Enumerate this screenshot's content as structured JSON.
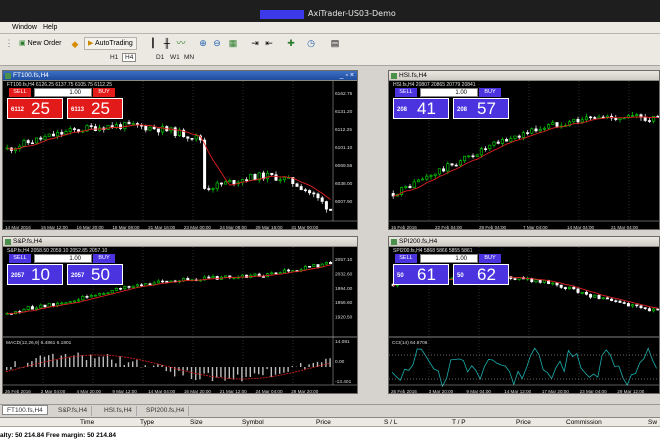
{
  "window": {
    "title": "AxiTrader-US03-Demo"
  },
  "menu": [
    "Window",
    "Help"
  ],
  "toolbar": {
    "new_order": "New Order",
    "autotrading": "AutoTrading",
    "timeframes": [
      "H1",
      "H4",
      "D1",
      "W1",
      "MN"
    ],
    "active_timeframe": "H4"
  },
  "charts": [
    {
      "title": "FT100.fs,H4",
      "info": "FT100.fs,H4  6126.25 6137.75 6105.75 6112.25",
      "active": true,
      "color": "#e41b1b",
      "panel": {
        "sell": "SELL",
        "buy": "BUY",
        "lot": "1.00",
        "sell_small": "6112",
        "sell_big": "25",
        "buy_small": "6113",
        "buy_big": "25"
      },
      "price_labels": [
        "6162.75",
        "6131.20",
        "6112.25",
        "6101.10",
        "6069.55",
        "6038.00",
        "6007.90"
      ],
      "date_labels": [
        "14 Mar 2016",
        "15 Mar 12:00",
        "16 Mar 20:00",
        "18 Mar 08:00",
        "21 Mar 16:00",
        "23 Mar 00:00",
        "24 Mar 08:00",
        "29 Mar 16:00",
        "31 Mar 00:00"
      ],
      "indicator": null
    },
    {
      "title": "HSI.fs,H4",
      "info": "HSI.fs,H4  20807 20865 20779 20841",
      "active": false,
      "color": "#4b33e0",
      "panel": {
        "sell": "SELL",
        "buy": "BUY",
        "lot": "1.00",
        "sell_small": "208",
        "sell_big": "41",
        "buy_small": "208",
        "buy_big": "57"
      },
      "price_labels": [],
      "date_labels": [
        "15 Feb 2016",
        "22 Feb 04:00",
        "29 Feb 04:00",
        "7 Mar 04:00",
        "14 Mar 04:00",
        "21 Mar 04:00"
      ],
      "indicator": null
    },
    {
      "title": "S&P.fs,H4",
      "info": "S&P.fs,H4  2058.50 2059.10 2052.85 2057.10",
      "active": false,
      "color": "#4b33e0",
      "panel": {
        "sell": "SELL",
        "buy": "BUY",
        "lot": "1.00",
        "sell_small": "2057",
        "sell_big": "10",
        "buy_small": "2057",
        "buy_big": "50"
      },
      "price_labels": [
        "2057.10",
        "2032.60",
        "1994.00",
        "1956.60",
        "1920.50"
      ],
      "date_labels": [
        "26 Feb 2016",
        "2 Mar 04:00",
        "4 Mar 20:00",
        "9 Mar 12:00",
        "14 Mar 04:00",
        "16 Mar 20:00",
        "21 Mar 12:00",
        "24 Mar 04:00",
        "29 Mar 20:00"
      ],
      "indicator": {
        "label": "MACD(12,26,9) 6.4861 6.1801",
        "levels": [
          "14.081",
          "0.00",
          "-13.401"
        ]
      }
    },
    {
      "title": "SPI200.fs,H4",
      "info": "SPI200.fs,H4  5868 5866 5855 5861",
      "active": false,
      "color": "#4b33e0",
      "panel": {
        "sell": "SELL",
        "buy": "BUY",
        "lot": "1.00",
        "sell_small": "50",
        "sell_big": "61",
        "buy_small": "50",
        "buy_big": "62"
      },
      "price_labels": [],
      "date_labels": [
        "26 Feb 2016",
        "3 Mar 20:00",
        "9 Mar 04:00",
        "14 Mar 12:00",
        "17 Mar 20:00",
        "23 Mar 04:00",
        "29 Mar 12:00"
      ],
      "indicator": {
        "label": "CCI(14) 64.8706",
        "levels": []
      }
    }
  ],
  "tabs": [
    "FT100.fs,H4",
    "S&P.fs,H4",
    "HSI.fs,H4",
    "SPI200.fs,H4"
  ],
  "terminal": {
    "columns": [
      "Time",
      "Type",
      "Size",
      "Symbol",
      "Price",
      "S / L",
      "T / P",
      "Price",
      "Commission",
      "Sw"
    ],
    "account_line": "alty: 50 214.84  Free margin: 50 214.84"
  }
}
